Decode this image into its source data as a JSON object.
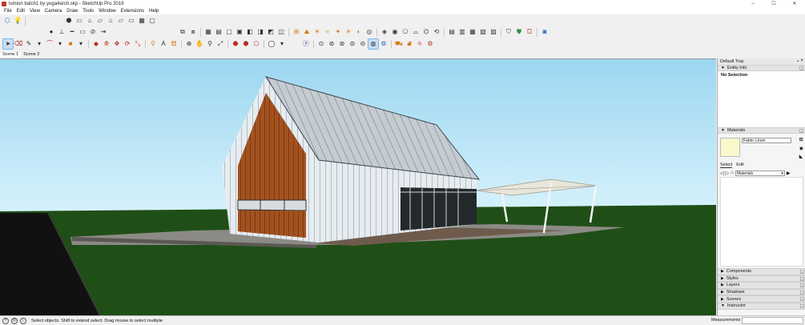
{
  "window": {
    "title": "lumion batch1 by yoga4arch.skp - SketchUp Pro 2019",
    "controls": {
      "minimize": "–",
      "maximize": "☐",
      "close": "✕"
    }
  },
  "menu": [
    "File",
    "Edit",
    "View",
    "Camera",
    "Draw",
    "Tools",
    "Window",
    "Extensions",
    "Help"
  ],
  "scenes": [
    "Scene 1",
    "Scene 2"
  ],
  "tray": {
    "title": "Default Tray",
    "entity_info": {
      "header": "Entity Info",
      "body": "No Selection"
    },
    "materials": {
      "header": "Materials",
      "current_name": "Fabric Linen",
      "swatch_color": "#fbf8cc",
      "tabs": [
        "Select",
        "Edit"
      ],
      "library": "Materials"
    },
    "collapsed_panels": [
      "Components",
      "Styles",
      "Layers",
      "Shadows",
      "Scenes",
      "Instructor"
    ]
  },
  "status": {
    "hint": "Select objects. Shift to extend select. Drag mouse to select multiple.",
    "measurements_label": "Measurements",
    "measurements_value": ""
  },
  "colors": {
    "sky_top": "#9cd6f1",
    "sky_bottom": "#d6f2fb",
    "grass": "#1f4f17",
    "roof": "#b9c2c8",
    "wood": "#9a4a1c",
    "cladding": "#e2e9ee",
    "deck": "#6e5b4c"
  }
}
